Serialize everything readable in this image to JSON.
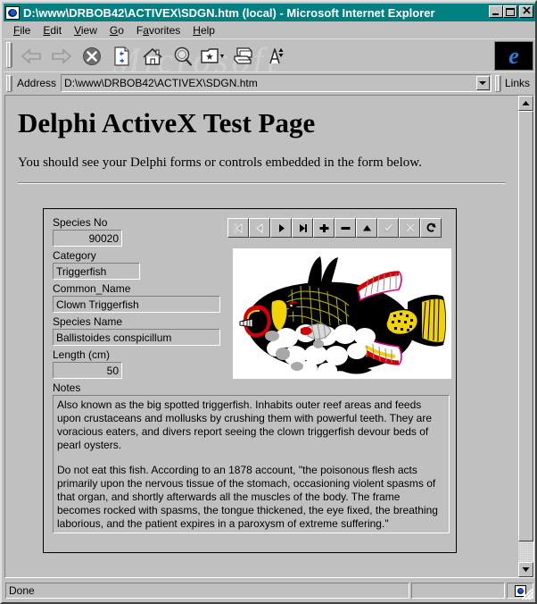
{
  "window": {
    "title": "D:\\www\\DRBOB42\\ACTIVEX\\SDGN.htm (local) - Microsoft Internet Explorer",
    "icon": "ie-document-icon",
    "buttons": {
      "minimize": "_",
      "maximize": "□",
      "close": "✕"
    }
  },
  "menu": {
    "items": [
      {
        "label": "File",
        "accel": "F"
      },
      {
        "label": "Edit",
        "accel": "E"
      },
      {
        "label": "View",
        "accel": "V"
      },
      {
        "label": "Go",
        "accel": "G"
      },
      {
        "label": "Favorites",
        "accel": "a"
      },
      {
        "label": "Help",
        "accel": "H"
      }
    ]
  },
  "toolbar": {
    "buttons": [
      {
        "name": "back-icon",
        "label": "Back",
        "enabled": false
      },
      {
        "name": "forward-icon",
        "label": "Forward",
        "enabled": false
      },
      {
        "name": "stop-icon",
        "label": "Stop",
        "enabled": true
      },
      {
        "name": "refresh-icon",
        "label": "Refresh",
        "enabled": true
      },
      {
        "name": "home-icon",
        "label": "Home",
        "enabled": true
      },
      {
        "name": "search-icon",
        "label": "Search",
        "enabled": true
      },
      {
        "name": "favorites-icon",
        "label": "Favorites",
        "enabled": true
      },
      {
        "name": "print-icon",
        "label": "Print",
        "enabled": true
      },
      {
        "name": "font-size-icon",
        "label": "Font",
        "enabled": true
      }
    ],
    "watermark": "Microsoft",
    "ie_logo": "e"
  },
  "address_bar": {
    "label": "Address",
    "value": "D:\\www\\DRBOB42\\ACTIVEX\\SDGN.htm",
    "links_label": "Links"
  },
  "document": {
    "heading": "Delphi ActiveX Test Page",
    "paragraph": "You should see your Delphi forms or controls embedded in the form below."
  },
  "form": {
    "navigator": [
      {
        "name": "nav-first-button",
        "glyph": "first",
        "enabled": false
      },
      {
        "name": "nav-prior-button",
        "glyph": "prior",
        "enabled": false
      },
      {
        "name": "nav-next-button",
        "glyph": "next",
        "enabled": true
      },
      {
        "name": "nav-last-button",
        "glyph": "last",
        "enabled": true
      },
      {
        "name": "nav-insert-button",
        "glyph": "plus",
        "enabled": true
      },
      {
        "name": "nav-delete-button",
        "glyph": "minus",
        "enabled": true
      },
      {
        "name": "nav-edit-button",
        "glyph": "up",
        "enabled": true
      },
      {
        "name": "nav-post-button",
        "glyph": "check",
        "enabled": false
      },
      {
        "name": "nav-cancel-button",
        "glyph": "cross",
        "enabled": false
      },
      {
        "name": "nav-refresh-button",
        "glyph": "refresh",
        "enabled": true
      }
    ],
    "fields": [
      {
        "label": "Species No",
        "value": "90020",
        "align": "right"
      },
      {
        "label": "Category",
        "value": "Triggerfish",
        "align": "left"
      },
      {
        "label": "Common_Name",
        "value": "Clown Triggerfish",
        "align": "left"
      },
      {
        "label": "Species Name",
        "value": "Ballistoides conspicillum",
        "align": "left"
      },
      {
        "label": "Length (cm)",
        "value": "50",
        "align": "right"
      }
    ],
    "notes_label": "Notes",
    "notes": [
      "Also known as the big spotted triggerfish.  Inhabits outer reef areas and feeds upon crustaceans and mollusks by crushing them with powerful teeth.  They are voracious eaters, and divers report seeing the clown triggerfish devour beds of pearl oysters.",
      "Do not eat this fish.  According to an 1878 account, \"the poisonous flesh acts primarily upon the nervous tissue of the stomach, occasioning violent spasms of that organ, and shortly afterwards all the muscles of the body.  The frame becomes rocked with spasms, the tongue thickened, the eye fixed, the breathing laborious, and the patient expires in a paroxysm of extreme suffering.\""
    ],
    "image_alt": "clown-triggerfish-illustration"
  },
  "status_bar": {
    "message": "Done",
    "progress": "",
    "zone_icon": "internet-zone-icon"
  },
  "colors": {
    "titlebar": "#008080",
    "face": "#c0c0c0",
    "shadow": "#808080",
    "highlight": "#ffffff",
    "ie_blue": "#2a7fe0"
  }
}
